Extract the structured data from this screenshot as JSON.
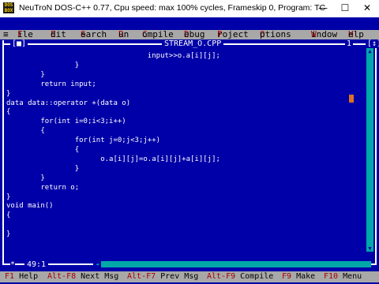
{
  "window": {
    "title": "NeuTroN DOS-C++ 0.77, Cpu speed: max 100% cycles, Frameskip  0, Program:      TC",
    "icon_label": "DOS BOX",
    "minimize_glyph": "—",
    "maximize_glyph": "☐",
    "close_glyph": "✕"
  },
  "menubar": {
    "system": "≡",
    "items": [
      {
        "hk": "F",
        "rest": "ile"
      },
      {
        "hk": "E",
        "rest": "dit"
      },
      {
        "hk": "S",
        "rest": "earch"
      },
      {
        "hk": "R",
        "rest": "un"
      },
      {
        "hk": "C",
        "rest": "ompile"
      },
      {
        "hk": "D",
        "rest": "ebug"
      },
      {
        "hk": "P",
        "rest": "roject"
      },
      {
        "hk": "O",
        "rest": "ptions"
      },
      {
        "hk": "W",
        "rest": "indow"
      },
      {
        "hk": "H",
        "rest": "elp"
      }
    ]
  },
  "editor": {
    "close_box": "[■]",
    "filename": "STREAM_O.CPP",
    "window_number": "1",
    "zoom_box": "[↕]",
    "position": "49:1",
    "modified_marker": "*",
    "lines": [
      "                                 input>>o.a[i][j];",
      "                }",
      "        }",
      "        return input;",
      "}",
      "data data::operator +(data o)",
      "{",
      "        for(int i=0;i<3;i++)",
      "        {",
      "                for(int j=0;j<3;j++)",
      "                {",
      "                      o.a[i][j]=o.a[i][j]+a[i][j];",
      "                }",
      "        }",
      "        return o;",
      "}",
      "void main()",
      "{",
      "",
      "}"
    ]
  },
  "statusbar": [
    {
      "key": "F1",
      "label": " Help"
    },
    {
      "key": "Alt-F8",
      "label": " Next Msg"
    },
    {
      "key": "Alt-F7",
      "label": " Prev Msg"
    },
    {
      "key": "Alt-F9",
      "label": " Compile"
    },
    {
      "key": "F9",
      "label": " Make"
    },
    {
      "key": "F10",
      "label": " Menu"
    }
  ],
  "colors": {
    "editor_bg": "#0000a8",
    "menu_bg": "#a8a8a8",
    "hotkey": "#a80000",
    "scrollbar": "#00a8a8"
  }
}
